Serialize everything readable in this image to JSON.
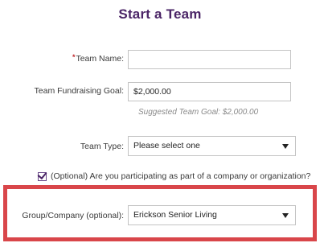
{
  "page": {
    "title": "Start a Team"
  },
  "form": {
    "team_name": {
      "required_marker": "*",
      "label": "Team Name:",
      "value": ""
    },
    "fundraising_goal": {
      "label": "Team Fundraising Goal:",
      "value": "$2,000.00",
      "hint": "Suggested Team Goal: $2,000.00"
    },
    "team_type": {
      "label": "Team Type:",
      "selected": "Please select one"
    },
    "company_checkbox": {
      "checked": true,
      "label": "(Optional) Are you participating as part of a company or organization?"
    },
    "group_company": {
      "label": "Group/Company (optional):",
      "selected": "Erickson Senior Living"
    }
  },
  "colors": {
    "title": "#4a2466",
    "highlight_border": "#d9464a",
    "required_marker": "#c0282d"
  },
  "icons": {
    "dropdown": "caret-down-icon",
    "checkbox": "checkmark-icon"
  }
}
